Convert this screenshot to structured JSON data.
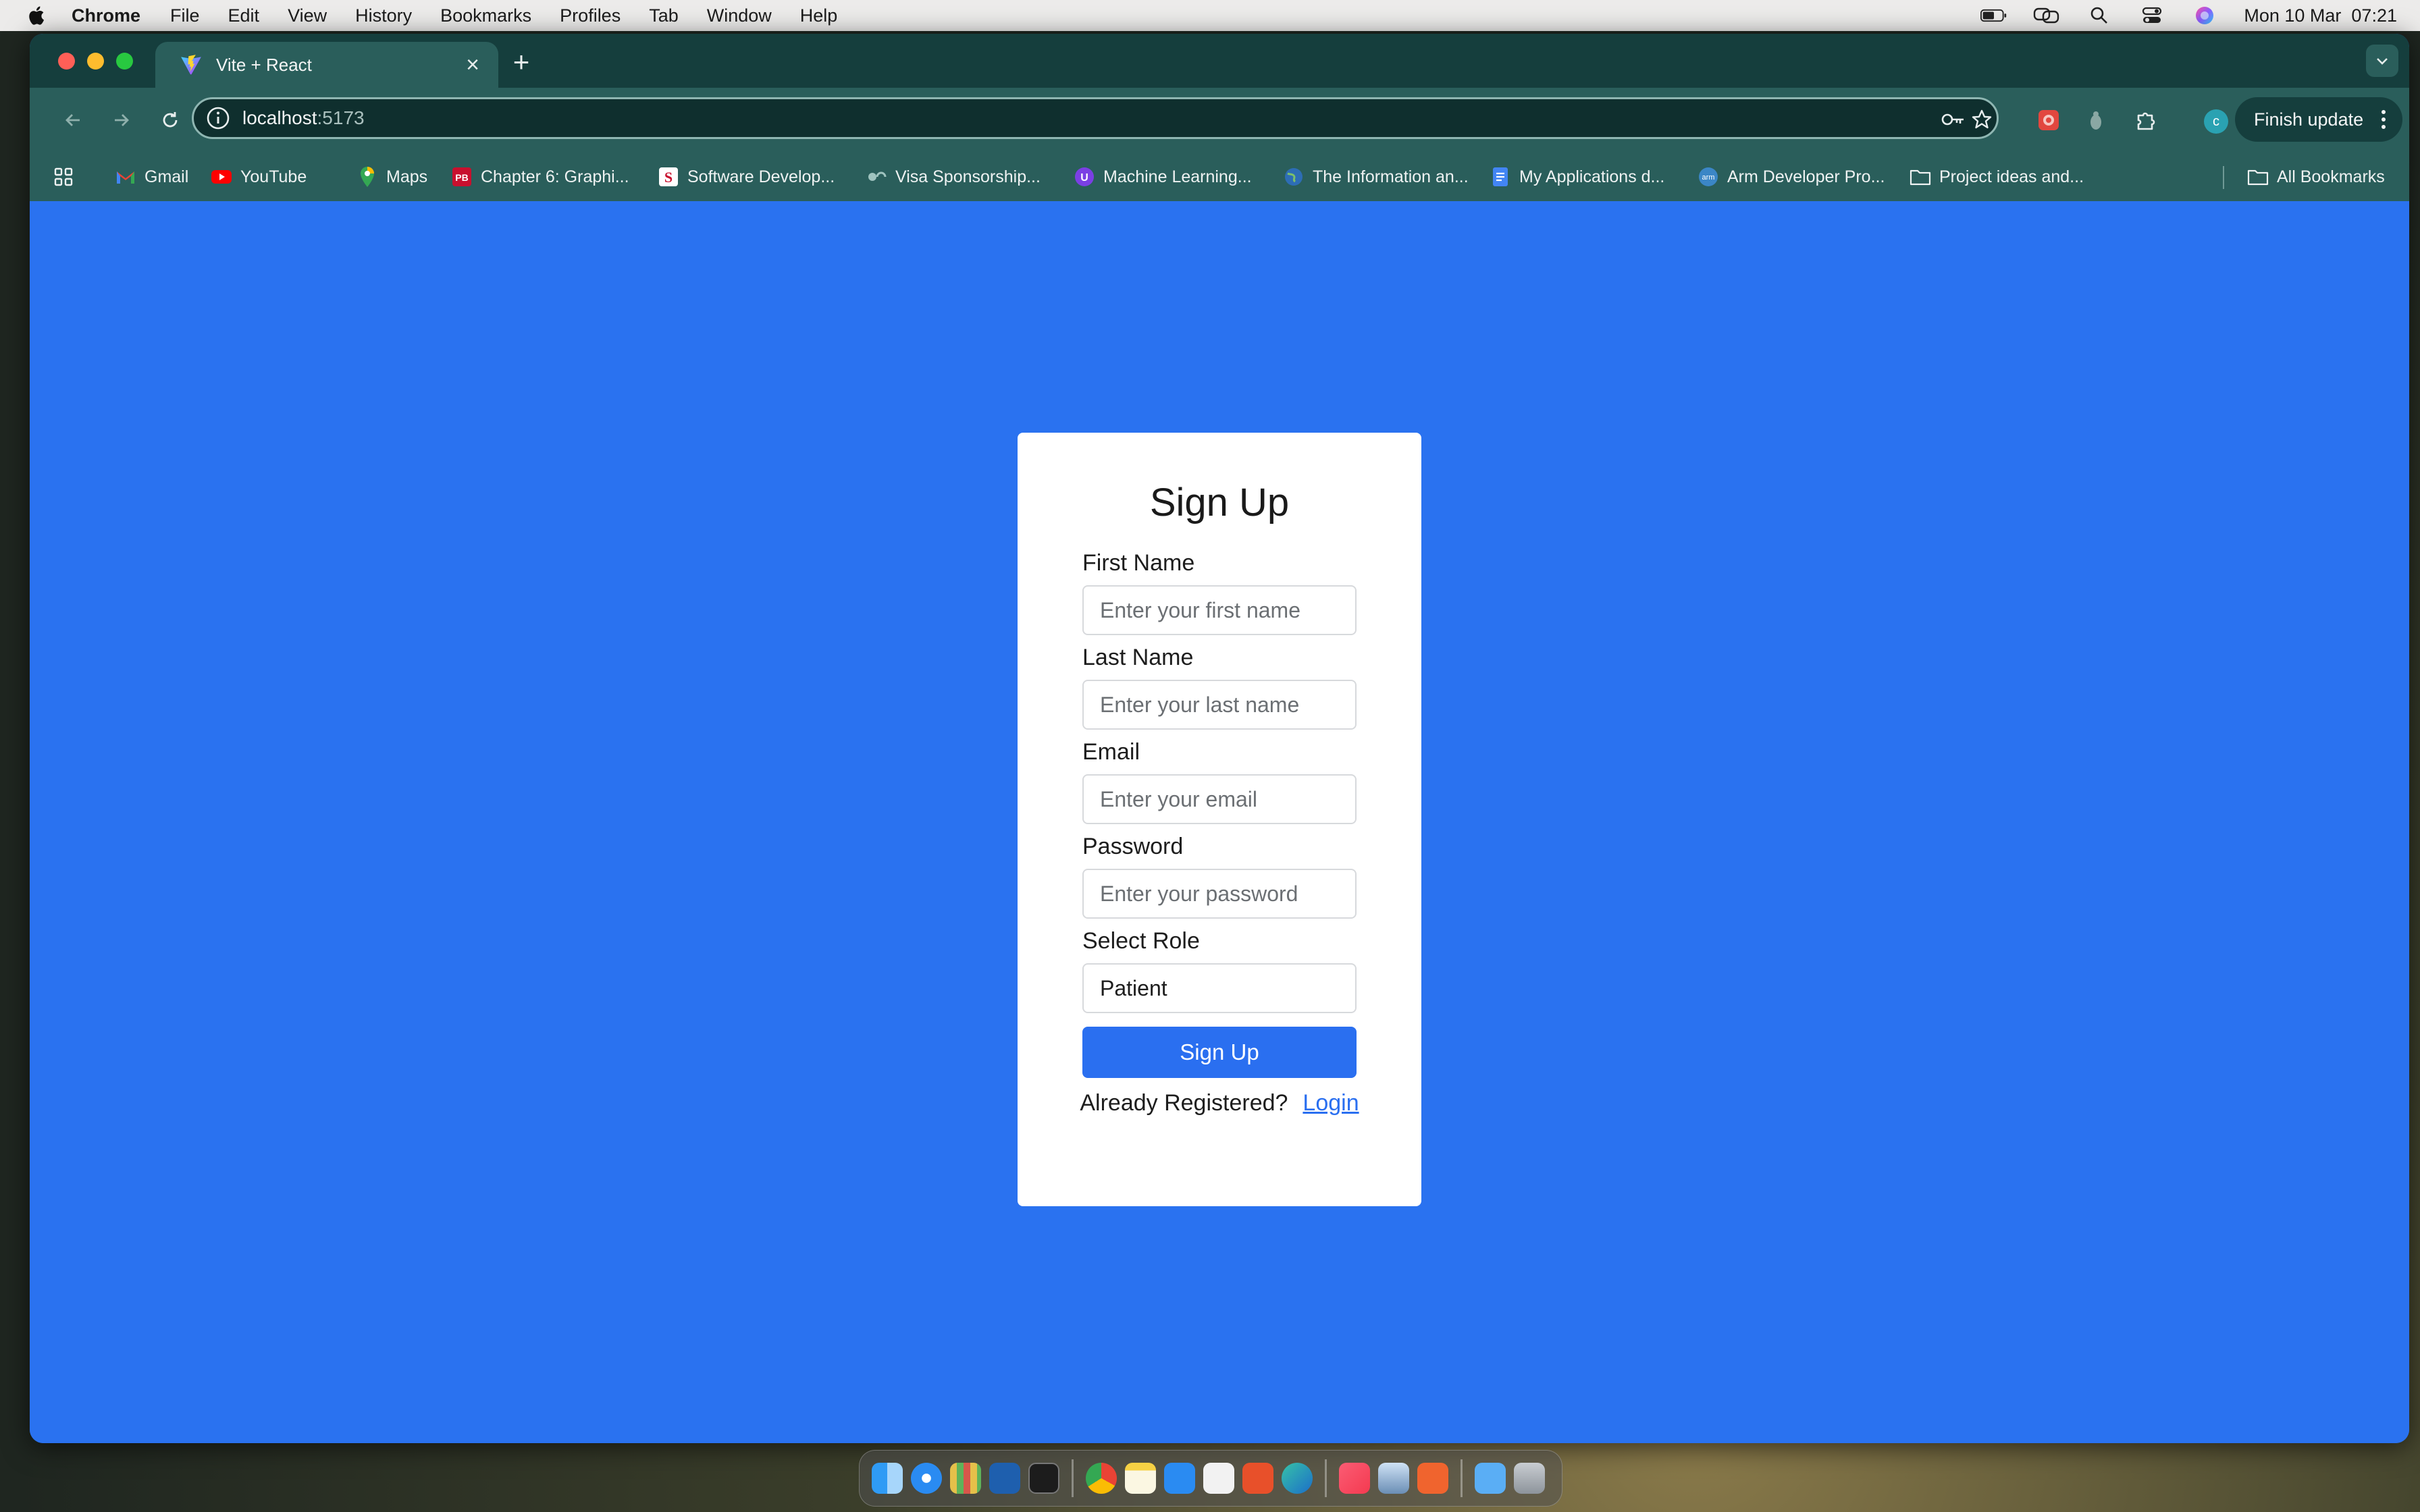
{
  "menubar": {
    "items": [
      "Chrome",
      "File",
      "Edit",
      "View",
      "History",
      "Bookmarks",
      "Profiles",
      "Tab",
      "Window",
      "Help"
    ],
    "datetime": "Mon 10 Mar  07:21"
  },
  "browser": {
    "tab_title": "Vite + React",
    "url_host": "localhost",
    "url_port": ":5173",
    "finish_update": "Finish update",
    "profile_initial": "c",
    "bookmarks": [
      "Gmail",
      "YouTube",
      "Maps",
      "Chapter 6: Graphi...",
      "Software Develop...",
      "Visa Sponsorship...",
      "Machine Learning...",
      "The Information an...",
      "My Applications d...",
      "Arm Developer Pro...",
      "Project ideas and..."
    ],
    "all_bookmarks": "All Bookmarks"
  },
  "form": {
    "title": "Sign Up",
    "first_name_label": "First Name",
    "first_name_placeholder": "Enter your first name",
    "last_name_label": "Last Name",
    "last_name_placeholder": "Enter your last name",
    "email_label": "Email",
    "email_placeholder": "Enter your email",
    "password_label": "Password",
    "password_placeholder": "Enter your password",
    "role_label": "Select Role",
    "role_value": "Patient",
    "submit_label": "Sign Up",
    "already_text": "Already Registered?",
    "login_link": "Login"
  },
  "colors": {
    "page_bg": "#2a72f0",
    "button_bg": "#2a6ff0",
    "chrome_frame": "#2a5e5b"
  }
}
